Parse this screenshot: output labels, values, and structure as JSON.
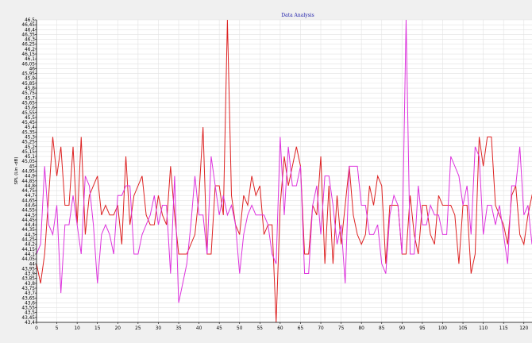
{
  "chart_data": {
    "type": "line",
    "title": "Data Analysis",
    "ylabel": "SPL (Lin -dB)",
    "xlabel": "",
    "xlim": [
      0,
      122
    ],
    "ylim": [
      43.4,
      46.5
    ],
    "y_ticks": [
      "43,4",
      "43,45",
      "43,5",
      "43,55",
      "43,6",
      "43,65",
      "43,7",
      "43,75",
      "43,8",
      "43,85",
      "43,9",
      "43,95",
      "44",
      "44,05",
      "44,1",
      "44,15",
      "44,2",
      "44,25",
      "44,3",
      "44,35",
      "44,4",
      "44,45",
      "44,5",
      "44,55",
      "44,6",
      "44,65",
      "44,7",
      "44,75",
      "44,8",
      "44,85",
      "44,9",
      "44,95",
      "45",
      "45,05",
      "45,1",
      "45,15",
      "45,2",
      "45,25",
      "45,3",
      "45,35",
      "45,4",
      "45,45",
      "45,5",
      "45,55",
      "45,6",
      "45,65",
      "45,7",
      "45,75",
      "45,8",
      "45,85",
      "45,9",
      "45,95",
      "46",
      "46,05",
      "46,1",
      "46,15",
      "46,2",
      "46,25",
      "46,3",
      "46,35",
      "46,4",
      "46,45",
      "46,5"
    ],
    "x_ticks": [
      0,
      5,
      10,
      15,
      20,
      25,
      30,
      35,
      40,
      45,
      50,
      55,
      60,
      65,
      70,
      75,
      80,
      85,
      90,
      95,
      100,
      105,
      110,
      115,
      120
    ],
    "grid": true,
    "legend": "none",
    "series": [
      {
        "color": "#dd2222",
        "values": [
          44.0,
          43.8,
          44.1,
          44.7,
          45.3,
          44.9,
          45.2,
          44.6,
          44.6,
          45.2,
          44.4,
          45.3,
          44.3,
          44.7,
          44.8,
          44.9,
          44.5,
          44.6,
          44.5,
          44.5,
          44.6,
          44.2,
          45.1,
          44.4,
          44.7,
          44.8,
          44.9,
          44.5,
          44.4,
          44.4,
          44.7,
          44.5,
          44.4,
          45.0,
          44.5,
          44.1,
          44.1,
          44.1,
          44.2,
          44.3,
          44.7,
          45.4,
          44.1,
          44.1,
          44.8,
          44.8,
          44.5,
          46.5,
          44.7,
          44.4,
          44.3,
          44.7,
          44.6,
          44.9,
          44.7,
          44.8,
          44.3,
          44.4,
          44.4,
          43.4,
          44.6,
          45.1,
          44.8,
          45.0,
          45.2,
          45.0,
          44.1,
          44.1,
          44.6,
          44.5,
          45.1,
          44.0,
          44.8,
          44.0,
          44.7,
          44.2,
          44.6,
          45.0,
          44.5,
          44.3,
          44.2,
          44.3,
          44.8,
          44.6,
          44.9,
          44.8,
          44.0,
          44.6,
          44.6,
          44.6,
          44.1,
          44.1,
          44.7,
          44.3,
          44.1,
          44.6,
          44.6,
          44.3,
          44.2,
          44.7,
          44.6,
          44.6,
          44.6,
          44.5,
          44.0,
          44.6,
          44.6,
          43.9,
          44.1,
          45.3,
          45.0,
          45.3,
          45.3,
          44.6,
          44.5,
          44.4,
          44.2,
          44.7,
          44.8,
          44.3,
          44.2,
          44.5,
          44.7,
          44.6,
          44.9
        ]
      },
      {
        "color": "#dd33dd",
        "values": [
          44.1,
          44.2,
          45.0,
          44.4,
          44.3,
          44.6,
          43.7,
          44.4,
          44.4,
          44.7,
          44.4,
          44.1,
          44.9,
          44.8,
          44.4,
          43.8,
          44.3,
          44.4,
          44.3,
          44.1,
          44.7,
          44.7,
          44.8,
          44.8,
          44.1,
          44.1,
          44.3,
          44.4,
          44.5,
          44.7,
          44.4,
          44.6,
          44.6,
          43.9,
          44.9,
          43.6,
          43.8,
          44.0,
          44.4,
          44.9,
          44.5,
          44.5,
          44.1,
          45.1,
          44.8,
          44.5,
          44.7,
          44.5,
          44.6,
          44.4,
          43.9,
          44.3,
          44.5,
          44.6,
          44.5,
          44.5,
          44.5,
          44.4,
          44.1,
          44.0,
          45.3,
          44.5,
          45.2,
          44.8,
          44.8,
          45.0,
          43.9,
          43.9,
          44.6,
          44.8,
          44.3,
          44.9,
          44.9,
          44.6,
          44.2,
          44.4,
          43.8,
          45.0,
          45.0,
          45.0,
          44.6,
          44.6,
          44.3,
          44.3,
          44.4,
          44.0,
          43.9,
          44.5,
          44.7,
          44.6,
          44.1,
          46.5,
          44.1,
          44.1,
          44.8,
          44.4,
          44.4,
          44.6,
          44.5,
          44.5,
          44.3,
          44.3,
          45.1,
          45.0,
          44.9,
          44.6,
          44.8,
          44.3,
          45.2,
          45.1,
          44.3,
          44.6,
          44.6,
          44.4,
          44.6,
          44.3,
          44.0,
          44.8,
          44.8,
          45.2,
          44.5,
          44.6,
          44.2
        ]
      }
    ]
  }
}
